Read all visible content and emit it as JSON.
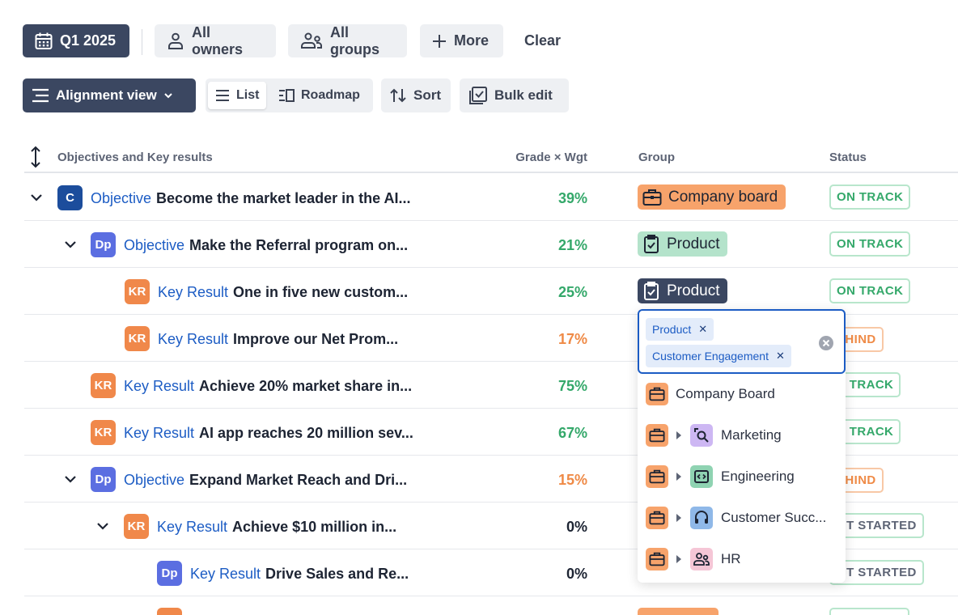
{
  "filters": {
    "period": "Q1 2025",
    "owners": "All owners",
    "groups": "All groups",
    "more": "More",
    "clear": "Clear"
  },
  "toolbar": {
    "view": "Alignment view",
    "list": "List",
    "roadmap": "Roadmap",
    "sort": "Sort",
    "bulk_edit": "Bulk edit"
  },
  "table": {
    "headers": {
      "okr": "Objectives and Key results",
      "grade": "Grade × Wgt",
      "group": "Group",
      "status": "Status"
    },
    "rows": [
      {
        "avatar": "C",
        "kind": "Objective",
        "title": "Become the market leader in the AI...",
        "grade": "39%",
        "group": "Company board",
        "status": "ON TRACK"
      },
      {
        "avatar": "Dp",
        "kind": "Objective",
        "title": "Make the Referral program on...",
        "grade": "21%",
        "group": "Product",
        "status": "ON TRACK"
      },
      {
        "avatar": "KR",
        "kind": "Key Result",
        "title": "One in five new custom...",
        "grade": "25%",
        "group": "Product",
        "status": "ON TRACK"
      },
      {
        "avatar": "KR",
        "kind": "Key Result",
        "title": "Improve our Net Prom...",
        "grade": "17%",
        "group": "",
        "status": "EHIND"
      },
      {
        "avatar": "KR",
        "kind": "Key Result",
        "title": "Achieve 20% market share in...",
        "grade": "75%",
        "group": "",
        "status": "N TRACK"
      },
      {
        "avatar": "KR",
        "kind": "Key Result",
        "title": "AI app reaches 20 million sev...",
        "grade": "67%",
        "group": "",
        "status": "N TRACK"
      },
      {
        "avatar": "Dp",
        "kind": "Objective",
        "title": "Expand Market Reach and Dri...",
        "grade": "15%",
        "group": "",
        "status": "EHIND"
      },
      {
        "avatar": "KR",
        "kind": "Key Result",
        "title": "Achieve $10 million in...",
        "grade": "0%",
        "group": "",
        "status": "OT STARTED"
      },
      {
        "avatar": "Dp",
        "kind": "Key Result",
        "title": "Drive Sales and Re...",
        "grade": "0%",
        "group": "",
        "status": "OT STARTED"
      }
    ]
  },
  "dropdown": {
    "selected": [
      "Product",
      "Customer Engagement"
    ],
    "options": [
      {
        "label": "Company Board"
      },
      {
        "label": "Marketing"
      },
      {
        "label": "Engineering"
      },
      {
        "label": "Customer Succ..."
      },
      {
        "label": "HR"
      }
    ]
  },
  "colors": {
    "primary_dark": "#3b4761",
    "link_blue": "#1c5cc4",
    "on_track_green": "#34a86a",
    "behind_orange": "#ef8a46",
    "company_board": "#f7a36b",
    "product_green": "#b4e3cb"
  }
}
